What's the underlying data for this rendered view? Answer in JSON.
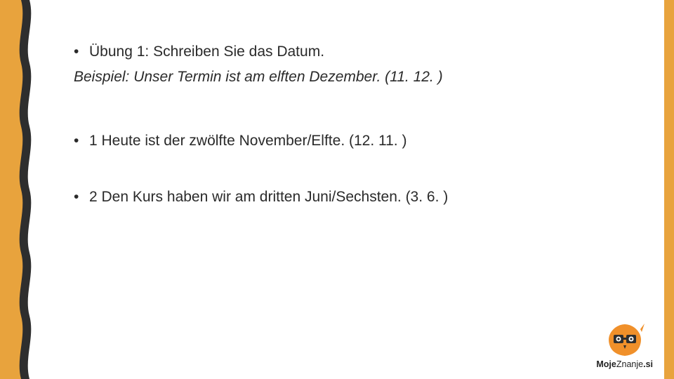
{
  "colors": {
    "wave_outer": "#2e2e2e",
    "wave_inner": "#e8a33d",
    "right_stripe": "#e8a33d"
  },
  "content": {
    "heading": "Übung 1: Schreiben Sie das Datum.",
    "example": "Beispiel: Unser Termin ist am elften Dezember. (11. 12. )",
    "items": [
      "1 Heute ist der  zwölfte November/Elfte. (12. 11. )",
      "2 Den Kurs haben wir am dritten Juni/Sechsten. (3. 6. )"
    ]
  },
  "brand": {
    "name_bold": "Moje",
    "name_mid": "Znanje",
    "name_tld": ".si",
    "mascot": "owl-mascot-icon"
  }
}
